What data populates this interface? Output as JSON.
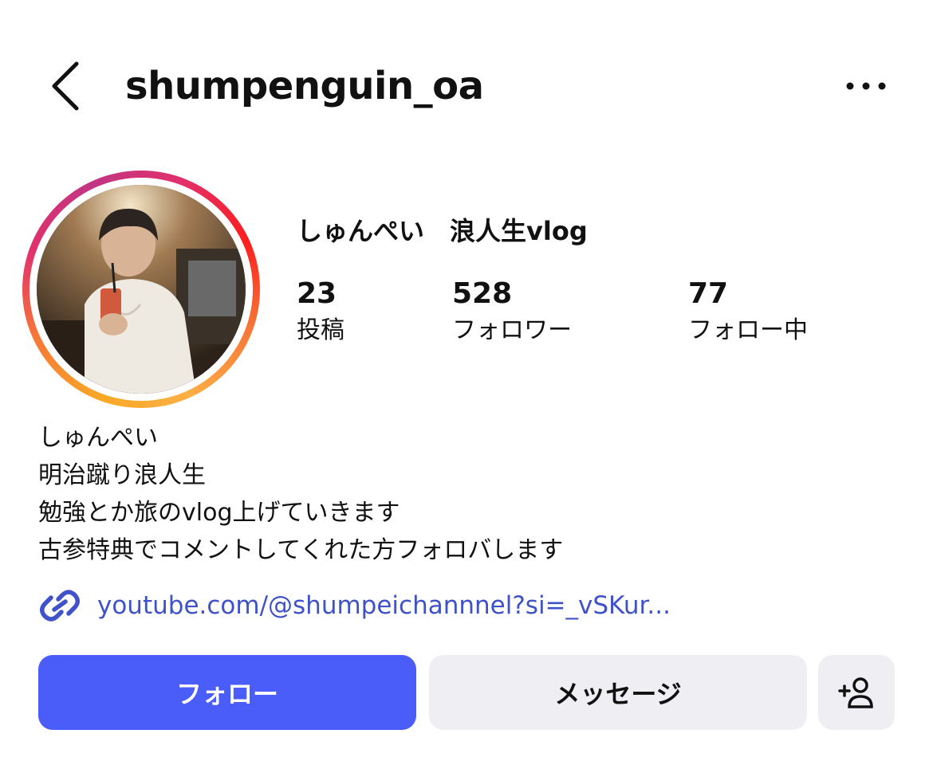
{
  "header": {
    "back_icon": "chevron-left-icon",
    "username": "shumpenguin_oa",
    "more_icon": "more-horizontal-icon"
  },
  "profile": {
    "display_name": "しゅんぺい　浪人生vlog",
    "stats": [
      {
        "value": "23",
        "label": "投稿"
      },
      {
        "value": "528",
        "label": "フォロワー"
      },
      {
        "value": "77",
        "label": "フォロー中"
      }
    ]
  },
  "bio": {
    "lines": [
      "しゅんぺい",
      "明治蹴り浪人生",
      "勉強とか旅のvlog上げていきます",
      "古参特典でコメントしてくれた方フォロバします"
    ],
    "link": {
      "icon": "link-icon",
      "text": "youtube.com/@shumpeichannnel?si=_vSKur..."
    }
  },
  "actions": {
    "follow_label": "フォロー",
    "message_label": "メッセージ",
    "add_user_icon": "add-user-icon"
  },
  "colors": {
    "accent": "#4a5df9",
    "link": "#3f52c9",
    "secondary_button": "#efeff3"
  }
}
